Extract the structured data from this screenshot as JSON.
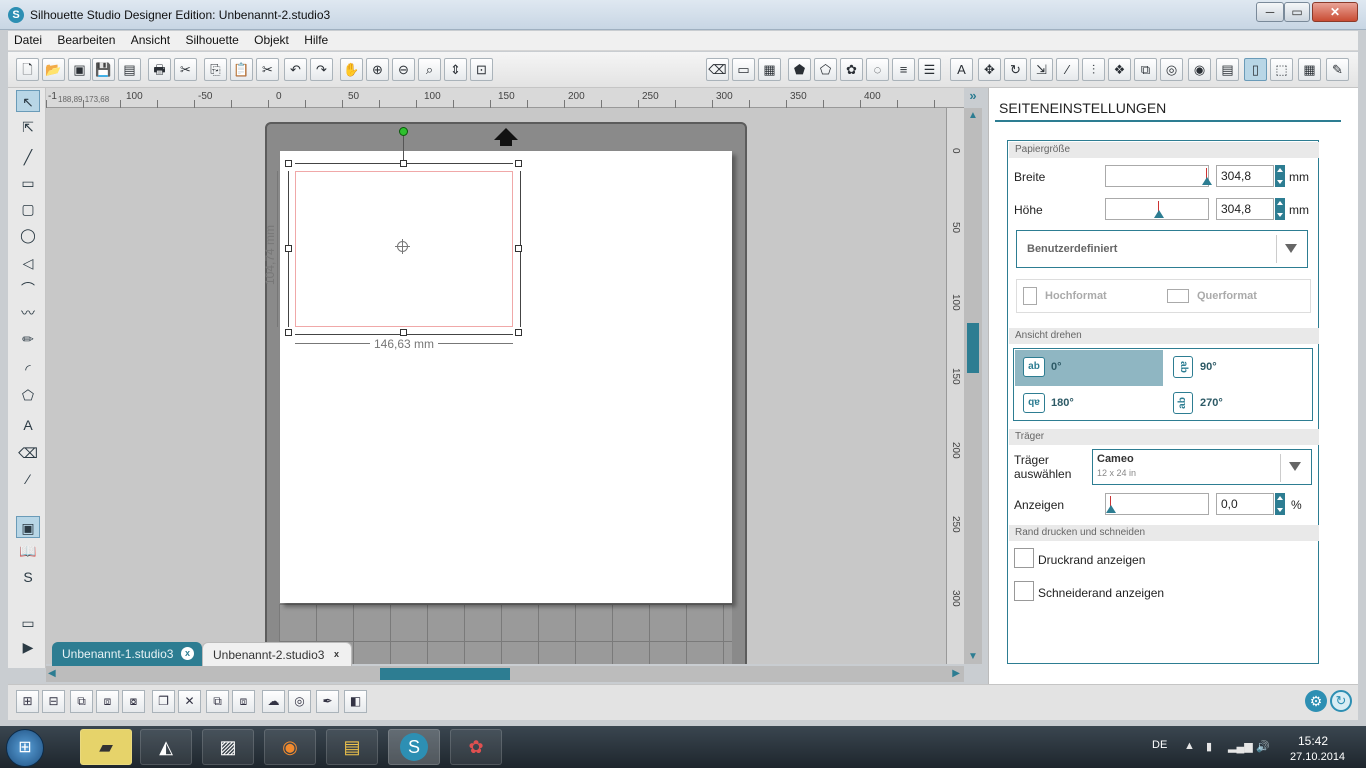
{
  "window": {
    "title": "Silhouette Studio Designer Edition: Unbenannt-2.studio3",
    "app_icon": "S",
    "min": "─",
    "max": "▭",
    "close": "✕"
  },
  "menu": [
    "Datei",
    "Bearbeiten",
    "Ansicht",
    "Silhouette",
    "Objekt",
    "Hilfe"
  ],
  "toolbar": {
    "left": [
      {
        "name": "new-document-icon",
        "glyph": "🗋"
      },
      {
        "name": "open-folder-icon",
        "glyph": "📂"
      },
      {
        "name": "open-library-icon",
        "glyph": "▣"
      },
      {
        "name": "save-icon",
        "glyph": "💾"
      },
      {
        "name": "save-to-library-icon",
        "glyph": "▤"
      },
      {
        "name": "print-icon",
        "glyph": "🖶"
      },
      {
        "name": "send-to-cutter-icon",
        "glyph": "✂"
      },
      {
        "name": "copy-icon",
        "glyph": "⎘"
      },
      {
        "name": "paste-icon",
        "glyph": "📋"
      },
      {
        "name": "cut-icon",
        "glyph": "✂"
      },
      {
        "name": "undo-icon",
        "glyph": "↶"
      },
      {
        "name": "redo-icon",
        "glyph": "↷"
      },
      {
        "name": "pan-hand-icon",
        "glyph": "✋"
      },
      {
        "name": "zoom-in-icon",
        "glyph": "⊕"
      },
      {
        "name": "zoom-out-icon",
        "glyph": "⊖"
      },
      {
        "name": "zoom-select-icon",
        "glyph": "⌕"
      },
      {
        "name": "zoom-drag-icon",
        "glyph": "⇕"
      },
      {
        "name": "fit-page-icon",
        "glyph": "⊡"
      }
    ],
    "right": [
      {
        "name": "eraser-icon",
        "glyph": "⌫"
      },
      {
        "name": "page-setup-icon",
        "glyph": "▭"
      },
      {
        "name": "grid-settings-icon",
        "glyph": "▦"
      },
      {
        "name": "fill-color-icon",
        "glyph": "⬟"
      },
      {
        "name": "fill-gradient-icon",
        "glyph": "⬠"
      },
      {
        "name": "fill-pattern-icon",
        "glyph": "✿"
      },
      {
        "name": "line-color-icon",
        "glyph": "◌"
      },
      {
        "name": "line-style-icon",
        "glyph": "≡"
      },
      {
        "name": "line-width-icon",
        "glyph": "☰"
      },
      {
        "name": "text-style-icon",
        "glyph": "A"
      },
      {
        "name": "transform-icon",
        "glyph": "✥"
      },
      {
        "name": "rotate-icon",
        "glyph": "↻"
      },
      {
        "name": "scale-icon",
        "glyph": "⇲"
      },
      {
        "name": "shear-icon",
        "glyph": "⁄"
      },
      {
        "name": "align-icon",
        "glyph": "⫶"
      },
      {
        "name": "replicate-icon",
        "glyph": "❖"
      },
      {
        "name": "modify-icon",
        "glyph": "⧉"
      },
      {
        "name": "offset-icon",
        "glyph": "◎"
      },
      {
        "name": "trace-icon",
        "glyph": "◉"
      },
      {
        "name": "cut-settings-icon",
        "glyph": "▤"
      },
      {
        "name": "send-icon",
        "glyph": "▯"
      },
      {
        "name": "store-icon",
        "glyph": "⬚"
      },
      {
        "name": "grid-view-icon",
        "glyph": "▦"
      },
      {
        "name": "draw-icon",
        "glyph": "✎"
      },
      {
        "name": "silhouette-store-icon",
        "glyph": "✐"
      }
    ]
  },
  "coords": {
    "x": "188,89",
    "y": "173,68"
  },
  "ruler": {
    "h": [
      "-1",
      "100",
      "-50",
      "0",
      "50",
      "100",
      "150",
      "200",
      "250",
      "300",
      "350",
      "400"
    ],
    "v": [
      "0",
      "50",
      "100",
      "150",
      "200",
      "250",
      "300"
    ]
  },
  "lefttools": [
    {
      "name": "select-arrow-icon",
      "glyph": "↖",
      "active": true
    },
    {
      "name": "point-edit-icon",
      "glyph": "⇱"
    },
    {
      "name": "line-tool-icon",
      "glyph": "╱"
    },
    {
      "name": "rectangle-tool-icon",
      "glyph": "▭"
    },
    {
      "name": "rounded-rect-tool-icon",
      "glyph": "▢"
    },
    {
      "name": "ellipse-tool-icon",
      "glyph": "◯"
    },
    {
      "name": "polygon-tool-icon",
      "glyph": "◁"
    },
    {
      "name": "curve-tool-icon",
      "glyph": "⌒"
    },
    {
      "name": "freehand-tool-icon",
      "glyph": "〰"
    },
    {
      "name": "smooth-freehand-icon",
      "glyph": "✏"
    },
    {
      "name": "arc-tool-icon",
      "glyph": "◜"
    },
    {
      "name": "regular-polygon-icon",
      "glyph": "⬠"
    },
    {
      "name": "text-tool-icon",
      "glyph": "A"
    },
    {
      "name": "eraser-tool-icon",
      "glyph": "⌫"
    },
    {
      "name": "knife-tool-icon",
      "glyph": "⁄"
    },
    {
      "name": "design-page-icon",
      "glyph": "▣",
      "active": true
    },
    {
      "name": "library-icon",
      "glyph": "📖"
    },
    {
      "name": "silhouette-store-icon",
      "glyph": "S"
    },
    {
      "name": "panel-toggle-icon",
      "glyph": "▭"
    },
    {
      "name": "expand-arrow-icon",
      "glyph": "▶"
    }
  ],
  "selection": {
    "width_label": "146,63 mm",
    "height_label": "104,74 mm"
  },
  "tabs": [
    {
      "label": "Unbenannt-1.studio3",
      "close": "x"
    },
    {
      "label": "Unbenannt-2.studio3",
      "close": "x"
    }
  ],
  "bottom": [
    {
      "name": "group-icon",
      "glyph": "⊞"
    },
    {
      "name": "ungroup-icon",
      "glyph": "⊟"
    },
    {
      "name": "compound-icon",
      "glyph": "⧉"
    },
    {
      "name": "release-compound-icon",
      "glyph": "⧈"
    },
    {
      "name": "bring-to-front-icon",
      "glyph": "⧇"
    },
    {
      "name": "duplicate-icon",
      "glyph": "❐"
    },
    {
      "name": "delete-icon",
      "glyph": "✕"
    },
    {
      "name": "send-back-icon",
      "glyph": "⧉"
    },
    {
      "name": "bring-forward-icon",
      "glyph": "⧈"
    },
    {
      "name": "weld-icon",
      "glyph": "☁"
    },
    {
      "name": "offset-icon",
      "glyph": "◎"
    },
    {
      "name": "trace-icon",
      "glyph": "✒"
    },
    {
      "name": "cut-icon",
      "glyph": "◧"
    }
  ],
  "panel": {
    "title": "SEITENEINSTELLUNGEN",
    "sections": {
      "paper": "Papiergröße",
      "rotate": "Ansicht drehen",
      "carrier": "Träger",
      "border": "Rand drucken und schneiden"
    },
    "width_label": "Breite",
    "width_value": "304,8",
    "height_label": "Höhe",
    "height_value": "304,8",
    "unit": "mm",
    "paper_preset": "Benutzerdefiniert",
    "portrait": "Hochformat",
    "landscape": "Querformat",
    "rotations": [
      {
        "label": "0°",
        "glyph": "ab",
        "active": true
      },
      {
        "label": "90°",
        "glyph": "ab"
      },
      {
        "label": "180°",
        "glyph": "qɐ"
      },
      {
        "label": "270°",
        "glyph": "ab"
      }
    ],
    "carrier_label": "Träger auswählen",
    "carrier_value": "Cameo",
    "carrier_sub": "12 x 24 in",
    "show_label": "Anzeigen",
    "show_value": "0,0",
    "show_unit": "%",
    "print_border": "Druckrand anzeigen",
    "cut_border": "Schneiderand anzeigen"
  },
  "taskbar": {
    "apps": [
      {
        "name": "start-icon",
        "glyph": "⊞"
      },
      {
        "name": "explorer-note-icon",
        "glyph": "▰"
      },
      {
        "name": "inkscape-icon",
        "glyph": "◭"
      },
      {
        "name": "picture-viewer-icon",
        "glyph": "▨"
      },
      {
        "name": "firefox-icon",
        "glyph": "◉"
      },
      {
        "name": "file-explorer-icon",
        "glyph": "▤"
      },
      {
        "name": "silhouette-studio-icon",
        "glyph": "S"
      },
      {
        "name": "picasa-icon",
        "glyph": "✿"
      }
    ],
    "lang": "DE",
    "time": "15:42",
    "date": "27.10.2014"
  },
  "colors": {
    "accent": "#2d7d92",
    "selection": "#f0a8a8",
    "rotate_handle": "#2ec02e"
  }
}
